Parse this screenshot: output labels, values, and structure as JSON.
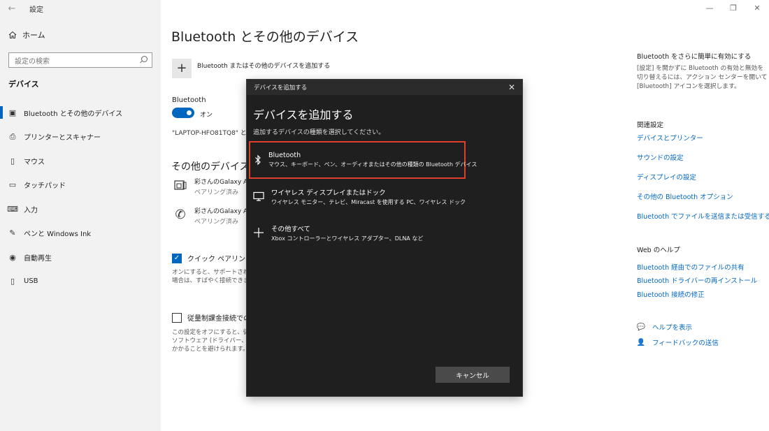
{
  "window": {
    "app_title": "設定",
    "back_glyph": "←",
    "controls": [
      "—",
      "❐",
      "✕"
    ]
  },
  "sidebar": {
    "home_label": "ホーム",
    "search_placeholder": "設定の検索",
    "section_label": "デバイス",
    "items": [
      {
        "label": "Bluetooth とその他のデバイス",
        "icon": "bluetooth-devices-icon",
        "active": true
      },
      {
        "label": "プリンターとスキャナー",
        "icon": "printer-icon",
        "active": false
      },
      {
        "label": "マウス",
        "icon": "mouse-icon",
        "active": false
      },
      {
        "label": "タッチパッド",
        "icon": "touchpad-icon",
        "active": false
      },
      {
        "label": "入力",
        "icon": "keyboard-icon",
        "active": false
      },
      {
        "label": "ペンと Windows Ink",
        "icon": "pen-icon",
        "active": false
      },
      {
        "label": "自動再生",
        "icon": "autoplay-icon",
        "active": false
      },
      {
        "label": "USB",
        "icon": "usb-icon",
        "active": false
      }
    ]
  },
  "main": {
    "title": "Bluetooth とその他のデバイス",
    "add_device_label": "Bluetooth またはその他のデバイスを追加する",
    "bluetooth_label": "Bluetooth",
    "toggle_state": "オン",
    "discoverable_text": "\"LAPTOP-HFO81TQ8\" と",
    "other_devices_title": "その他のデバイス",
    "devices": [
      {
        "name": "彩さんのGalaxy A2",
        "state": "ペアリング済み",
        "icon": "phone-device-icon"
      },
      {
        "name": "彩さんのGalaxy A2",
        "state": "ペアリング済み",
        "icon": "phone-call-icon"
      }
    ],
    "quick_pairing_label": "クイック ペアリングを使",
    "quick_pairing_desc": [
      "オンにすると、サポートされて",
      "場合は、すばやく接続できま"
    ],
    "metered_label": "従量制課金接続での",
    "metered_desc": [
      "この設定をオフにすると、従",
      "ソフトウェア (ドライバー、情報",
      "かかることを避けられます。"
    ]
  },
  "right": {
    "easy_heading": "Bluetooth をさらに簡単に有効にする",
    "easy_desc": "[設定] を開かずに Bluetooth の有効と無効を切り替えるには、アクション センターを開いて [Bluetooth] アイコンを選択します。",
    "related_heading": "関連設定",
    "related_links": [
      "デバイスとプリンター",
      "サウンドの設定",
      "ディスプレイの設定",
      "その他の Bluetooth オプション",
      "Bluetooth でファイルを送信または受信する"
    ],
    "web_help_heading": "Web のヘルプ",
    "web_links": [
      "Bluetooth 経由でのファイルの共有",
      "Bluetooth ドライバーの再インストール",
      "Bluetooth 接続の修正"
    ],
    "help_label": "ヘルプを表示",
    "feedback_label": "フィードバックの送信"
  },
  "dialog": {
    "bar_title": "デバイスを追加する",
    "close_glyph": "✕",
    "title": "デバイスを追加する",
    "subtitle": "追加するデバイスの種類を選択してください。",
    "options": [
      {
        "name": "Bluetooth",
        "desc": "マウス、キーボード、ペン、オーディオまたはその他の種類の Bluetooth デバイス",
        "icon": "bluetooth-icon",
        "selected": true
      },
      {
        "name": "ワイヤレス ディスプレイまたはドック",
        "desc": "ワイヤレス モニター、テレビ、Miracast を使用する PC、ワイヤレス ドック",
        "icon": "monitor-icon",
        "selected": false
      },
      {
        "name": "その他すべて",
        "desc": "Xbox コントローラーとワイヤレス アダプター、DLNA など",
        "icon": "plus-icon",
        "selected": false
      }
    ],
    "cancel_label": "キャンセル"
  },
  "colors": {
    "accent": "#0067c0",
    "highlight": "#e0402b",
    "dialog_bg": "#1f1f1f"
  }
}
